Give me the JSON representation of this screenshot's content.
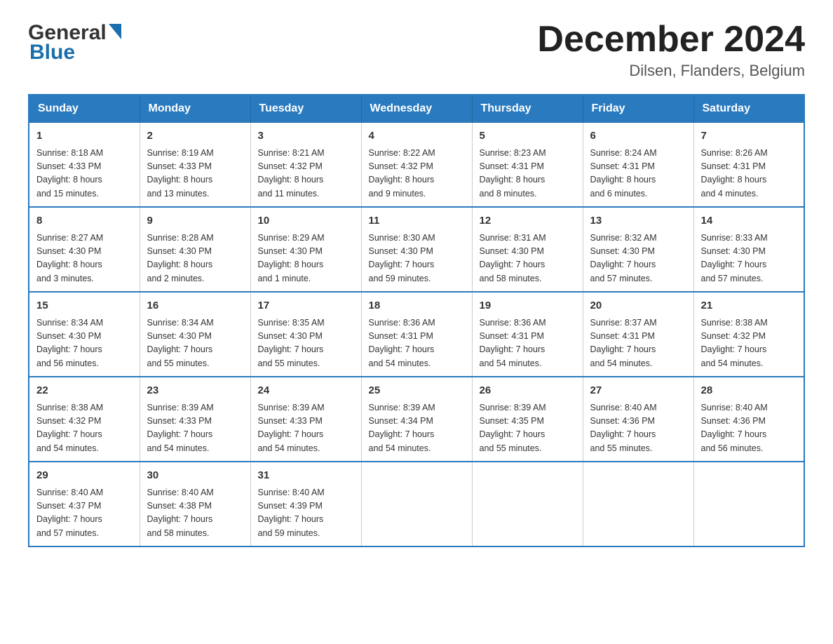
{
  "header": {
    "month_title": "December 2024",
    "location": "Dilsen, Flanders, Belgium",
    "logo_general": "General",
    "logo_blue": "Blue"
  },
  "days_of_week": [
    "Sunday",
    "Monday",
    "Tuesday",
    "Wednesday",
    "Thursday",
    "Friday",
    "Saturday"
  ],
  "weeks": [
    [
      {
        "day": "1",
        "sunrise": "8:18 AM",
        "sunset": "4:33 PM",
        "daylight": "8 hours and 15 minutes."
      },
      {
        "day": "2",
        "sunrise": "8:19 AM",
        "sunset": "4:33 PM",
        "daylight": "8 hours and 13 minutes."
      },
      {
        "day": "3",
        "sunrise": "8:21 AM",
        "sunset": "4:32 PM",
        "daylight": "8 hours and 11 minutes."
      },
      {
        "day": "4",
        "sunrise": "8:22 AM",
        "sunset": "4:32 PM",
        "daylight": "8 hours and 9 minutes."
      },
      {
        "day": "5",
        "sunrise": "8:23 AM",
        "sunset": "4:31 PM",
        "daylight": "8 hours and 8 minutes."
      },
      {
        "day": "6",
        "sunrise": "8:24 AM",
        "sunset": "4:31 PM",
        "daylight": "8 hours and 6 minutes."
      },
      {
        "day": "7",
        "sunrise": "8:26 AM",
        "sunset": "4:31 PM",
        "daylight": "8 hours and 4 minutes."
      }
    ],
    [
      {
        "day": "8",
        "sunrise": "8:27 AM",
        "sunset": "4:30 PM",
        "daylight": "8 hours and 3 minutes."
      },
      {
        "day": "9",
        "sunrise": "8:28 AM",
        "sunset": "4:30 PM",
        "daylight": "8 hours and 2 minutes."
      },
      {
        "day": "10",
        "sunrise": "8:29 AM",
        "sunset": "4:30 PM",
        "daylight": "8 hours and 1 minute."
      },
      {
        "day": "11",
        "sunrise": "8:30 AM",
        "sunset": "4:30 PM",
        "daylight": "7 hours and 59 minutes."
      },
      {
        "day": "12",
        "sunrise": "8:31 AM",
        "sunset": "4:30 PM",
        "daylight": "7 hours and 58 minutes."
      },
      {
        "day": "13",
        "sunrise": "8:32 AM",
        "sunset": "4:30 PM",
        "daylight": "7 hours and 57 minutes."
      },
      {
        "day": "14",
        "sunrise": "8:33 AM",
        "sunset": "4:30 PM",
        "daylight": "7 hours and 57 minutes."
      }
    ],
    [
      {
        "day": "15",
        "sunrise": "8:34 AM",
        "sunset": "4:30 PM",
        "daylight": "7 hours and 56 minutes."
      },
      {
        "day": "16",
        "sunrise": "8:34 AM",
        "sunset": "4:30 PM",
        "daylight": "7 hours and 55 minutes."
      },
      {
        "day": "17",
        "sunrise": "8:35 AM",
        "sunset": "4:30 PM",
        "daylight": "7 hours and 55 minutes."
      },
      {
        "day": "18",
        "sunrise": "8:36 AM",
        "sunset": "4:31 PM",
        "daylight": "7 hours and 54 minutes."
      },
      {
        "day": "19",
        "sunrise": "8:36 AM",
        "sunset": "4:31 PM",
        "daylight": "7 hours and 54 minutes."
      },
      {
        "day": "20",
        "sunrise": "8:37 AM",
        "sunset": "4:31 PM",
        "daylight": "7 hours and 54 minutes."
      },
      {
        "day": "21",
        "sunrise": "8:38 AM",
        "sunset": "4:32 PM",
        "daylight": "7 hours and 54 minutes."
      }
    ],
    [
      {
        "day": "22",
        "sunrise": "8:38 AM",
        "sunset": "4:32 PM",
        "daylight": "7 hours and 54 minutes."
      },
      {
        "day": "23",
        "sunrise": "8:39 AM",
        "sunset": "4:33 PM",
        "daylight": "7 hours and 54 minutes."
      },
      {
        "day": "24",
        "sunrise": "8:39 AM",
        "sunset": "4:33 PM",
        "daylight": "7 hours and 54 minutes."
      },
      {
        "day": "25",
        "sunrise": "8:39 AM",
        "sunset": "4:34 PM",
        "daylight": "7 hours and 54 minutes."
      },
      {
        "day": "26",
        "sunrise": "8:39 AM",
        "sunset": "4:35 PM",
        "daylight": "7 hours and 55 minutes."
      },
      {
        "day": "27",
        "sunrise": "8:40 AM",
        "sunset": "4:36 PM",
        "daylight": "7 hours and 55 minutes."
      },
      {
        "day": "28",
        "sunrise": "8:40 AM",
        "sunset": "4:36 PM",
        "daylight": "7 hours and 56 minutes."
      }
    ],
    [
      {
        "day": "29",
        "sunrise": "8:40 AM",
        "sunset": "4:37 PM",
        "daylight": "7 hours and 57 minutes."
      },
      {
        "day": "30",
        "sunrise": "8:40 AM",
        "sunset": "4:38 PM",
        "daylight": "7 hours and 58 minutes."
      },
      {
        "day": "31",
        "sunrise": "8:40 AM",
        "sunset": "4:39 PM",
        "daylight": "7 hours and 59 minutes."
      },
      null,
      null,
      null,
      null
    ]
  ],
  "labels": {
    "sunrise": "Sunrise:",
    "sunset": "Sunset:",
    "daylight": "Daylight:"
  }
}
